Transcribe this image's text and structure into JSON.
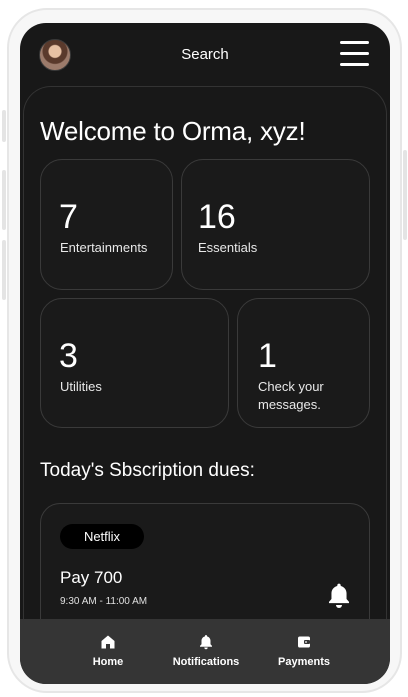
{
  "header": {
    "title": "Search"
  },
  "welcome": "Welcome to Orma, xyz!",
  "cards": [
    {
      "count": "7",
      "label": "Entertainments"
    },
    {
      "count": "16",
      "label": "Essentials"
    },
    {
      "count": "3",
      "label": "Utilities"
    },
    {
      "count": "1",
      "label": "Check your messages."
    }
  ],
  "dues": {
    "title": "Today's Sbscription dues:",
    "item": {
      "service": "Netflix",
      "pay": "Pay 700",
      "time": "9:30 AM - 11:00 AM"
    }
  },
  "nav": [
    {
      "label": "Home",
      "icon": "home-icon"
    },
    {
      "label": "Notifications",
      "icon": "bell-icon"
    },
    {
      "label": "Payments",
      "icon": "wallet-icon"
    }
  ]
}
